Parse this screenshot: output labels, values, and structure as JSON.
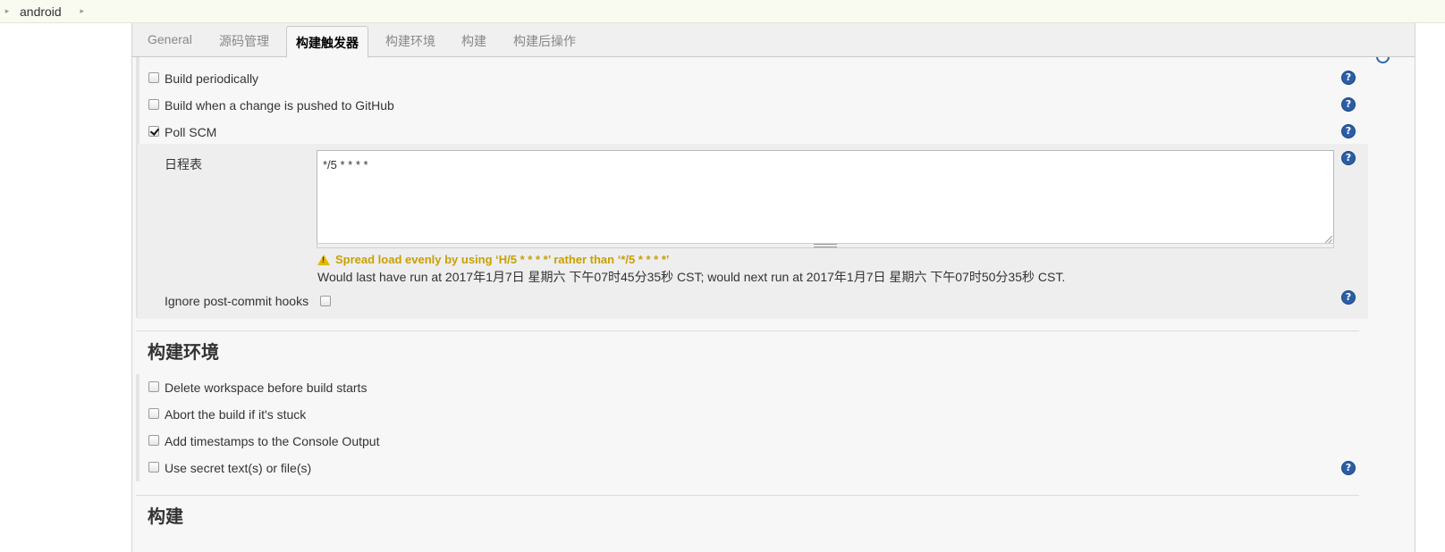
{
  "breadcrumb": {
    "project": "android"
  },
  "tabs": [
    {
      "label": "General"
    },
    {
      "label": "源码管理"
    },
    {
      "label": "构建触发器"
    },
    {
      "label": "构建环境"
    },
    {
      "label": "构建"
    },
    {
      "label": "构建后操作"
    }
  ],
  "active_tab_index": 2,
  "triggers": {
    "build_periodically": {
      "label": "Build periodically",
      "checked": false
    },
    "github_push": {
      "label": "Build when a change is pushed to GitHub",
      "checked": false
    },
    "poll_scm": {
      "label": "Poll SCM",
      "checked": true
    },
    "schedule": {
      "label": "日程表",
      "value": "*/5 * * * *",
      "warning": "Spread load evenly by using ‘H/5 * * * *’ rather than ‘*/5 * * * *’",
      "run_info": "Would last have run at 2017年1月7日 星期六 下午07时45分35秒 CST; would next run at 2017年1月7日 星期六 下午07时50分35秒 CST."
    },
    "ignore_hooks": {
      "label": "Ignore post-commit hooks",
      "checked": false
    }
  },
  "build_env": {
    "title": "构建环境",
    "delete_workspace": {
      "label": "Delete workspace before build starts",
      "checked": false
    },
    "abort_stuck": {
      "label": "Abort the build if it's stuck",
      "checked": false
    },
    "timestamps": {
      "label": "Add timestamps to the Console Output",
      "checked": false
    },
    "secret_text": {
      "label": "Use secret text(s) or file(s)",
      "checked": false
    }
  },
  "build": {
    "title": "构建"
  },
  "colors": {
    "help": "#2a5ea6",
    "warning": "#c9a000",
    "active_tab_text": "#000000"
  },
  "help_glyph": "?"
}
